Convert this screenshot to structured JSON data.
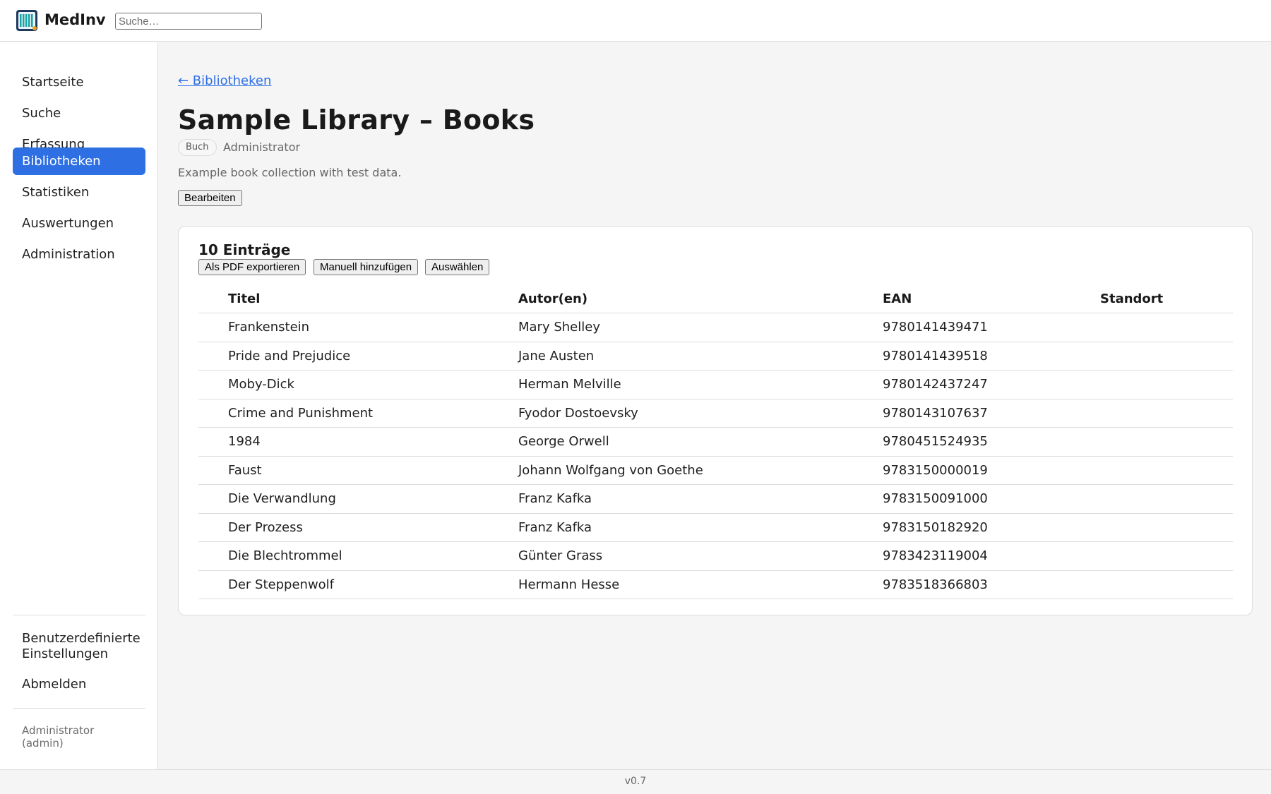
{
  "header": {
    "app_name": "MedInv",
    "logo_icon": "library-books-icon",
    "search_placeholder": "Suche…"
  },
  "sidebar": {
    "items": [
      {
        "label": "Startseite",
        "active": false
      },
      {
        "label": "Suche",
        "active": false
      },
      {
        "label": "Erfassung",
        "active": false
      },
      {
        "label": "Bibliotheken",
        "active": true
      },
      {
        "label": "Statistiken",
        "active": false
      },
      {
        "label": "Auswertungen",
        "active": false
      },
      {
        "label": "Administration",
        "active": false
      }
    ],
    "settings_label": "Benutzerdefinierte Einstellungen",
    "logout_label": "Abmelden",
    "user_name": "Administrator",
    "user_login": "(admin)"
  },
  "main": {
    "back_link": "← Bibliotheken",
    "title": "Sample Library – Books",
    "type_badge": "Buch",
    "owner": "Administrator",
    "description": "Example book collection with test data.",
    "edit_button": "Bearbeiten",
    "entries_heading": "10 Einträge",
    "export_pdf_button": "Als PDF exportieren",
    "add_manual_button": "Manuell hinzufügen",
    "select_button": "Auswählen",
    "table": {
      "columns": [
        "Titel",
        "Autor(en)",
        "EAN",
        "Standort"
      ],
      "rows": [
        [
          "Frankenstein",
          "Mary Shelley",
          "9780141439471",
          ""
        ],
        [
          "Pride and Prejudice",
          "Jane Austen",
          "9780141439518",
          ""
        ],
        [
          "Moby-Dick",
          "Herman Melville",
          "9780142437247",
          ""
        ],
        [
          "Crime and Punishment",
          "Fyodor Dostoevsky",
          "9780143107637",
          ""
        ],
        [
          "1984",
          "George Orwell",
          "9780451524935",
          ""
        ],
        [
          "Faust",
          "Johann Wolfgang von Goethe",
          "9783150000019",
          ""
        ],
        [
          "Die Verwandlung",
          "Franz Kafka",
          "9783150091000",
          ""
        ],
        [
          "Der Prozess",
          "Franz Kafka",
          "9783150182920",
          ""
        ],
        [
          "Die Blechtrommel",
          "Günter Grass",
          "9783423119004",
          ""
        ],
        [
          "Der Steppenwolf",
          "Hermann Hesse",
          "9783518366803",
          ""
        ]
      ]
    }
  },
  "footer": {
    "version": "v0.7"
  },
  "colors": {
    "accent": "#2f6fe4",
    "background": "#f5f5f5"
  }
}
